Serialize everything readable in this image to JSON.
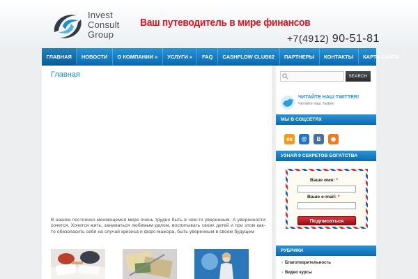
{
  "header": {
    "logo_lines": [
      "Invest",
      "Consult",
      "Group"
    ],
    "tagline": "Ваш путеводитель в мире финансов",
    "phone_prefix": "+7(4912)",
    "phone_number": "90-51-81"
  },
  "nav": {
    "items": [
      {
        "label": "Главная"
      },
      {
        "label": "Новости"
      },
      {
        "label": "О компании »"
      },
      {
        "label": "Услуги »"
      },
      {
        "label": "FAQ"
      },
      {
        "label": "Cashflow Club62"
      },
      {
        "label": "Партнеры"
      },
      {
        "label": "Контакты"
      },
      {
        "label": "Карта сайта"
      }
    ]
  },
  "main": {
    "page_title": "Главная",
    "intro": "В нашем постоянно меняющемся мире очень трудно быть в чем-то уверенным. А уверенности хочется. Хочется жить, заниматься любимым делом, воспитывать своих детей и при этом как-то обезопасить себя на случай кризиса и форс-мажора, быть уверенным в своем будущем"
  },
  "sidebar": {
    "search_placeholder": "",
    "search_button": "SEARCH",
    "twitter_title": "ЧИТАЙТЕ НАШ TWITTER!",
    "twitter_sub": "Читайте наш Twitter!",
    "social_head": "Мы в соцсетях",
    "social_icons": [
      {
        "name": "odnoklassniki-icon",
        "color": "#f39a1d",
        "glyph": "ок"
      },
      {
        "name": "mail-ru-icon",
        "color": "#1f74c9",
        "glyph": "@"
      },
      {
        "name": "vkontakte-icon",
        "color": "#4b6f9c",
        "glyph": "В"
      },
      {
        "name": "rss-icon",
        "color": "#f07a20",
        "glyph": "◉"
      }
    ],
    "secrets_head": "Узнай 9 секретов богатства",
    "form": {
      "name_label": "Ваше имя:",
      "email_label": "Ваше e-mail:",
      "required_mark": "*",
      "subscribe": "Подписаться"
    },
    "rubrics_head": "Рубрики",
    "rubrics": [
      {
        "label": "Благотворительность"
      },
      {
        "label": "Видео курсы"
      }
    ]
  },
  "colors": {
    "accent": "#1a8ed0",
    "nav": "#0a6ab0",
    "brand_red": "#e0121a"
  }
}
